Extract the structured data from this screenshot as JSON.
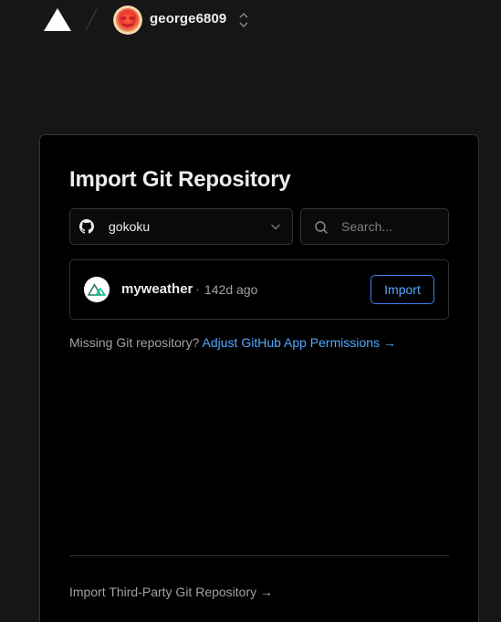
{
  "header": {
    "username": "george6809"
  },
  "import": {
    "title": "Import Git Repository",
    "account_select": {
      "value": "gokoku"
    },
    "search": {
      "placeholder": "Search..."
    },
    "repos": [
      {
        "name": "myweather",
        "separator": "·",
        "updated": "142d ago",
        "action": "Import"
      }
    ],
    "missing_text": "Missing Git repository?",
    "missing_link": "Adjust GitHub App Permissions →",
    "third_party_link": "Import Third-Party Git Repository →"
  },
  "colors": {
    "background": "#161616",
    "card": "#000000",
    "border": "#333333",
    "accent_link": "#52a8ff",
    "accent_border": "#3b82f6"
  }
}
